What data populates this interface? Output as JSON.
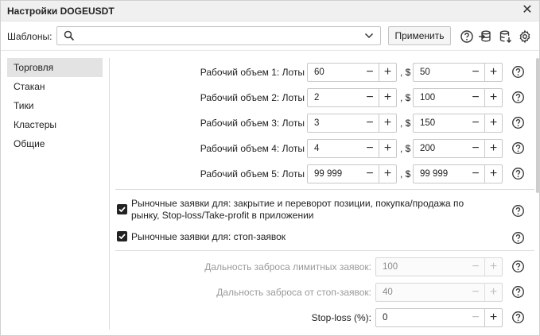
{
  "window": {
    "title": "Настройки DOGEUSDT"
  },
  "templates": {
    "label": "Шаблоны:",
    "value": "",
    "apply_label": "Применить"
  },
  "toolbar_icons": [
    "help-icon",
    "import-icon",
    "database-icon",
    "gear-icon"
  ],
  "sidebar": {
    "items": [
      {
        "label": "Торговля",
        "active": true
      },
      {
        "label": "Стакан",
        "active": false
      },
      {
        "label": "Тики",
        "active": false
      },
      {
        "label": "Кластеры",
        "active": false
      },
      {
        "label": "Общие",
        "active": false
      }
    ]
  },
  "volumes": [
    {
      "label": "Рабочий объем 1: Лоты",
      "lots": "60",
      "usd_sep": ", $",
      "usd": "50"
    },
    {
      "label": "Рабочий объем 2: Лоты",
      "lots": "2",
      "usd_sep": ", $",
      "usd": "100"
    },
    {
      "label": "Рабочий объем 3: Лоты",
      "lots": "3",
      "usd_sep": ", $",
      "usd": "150"
    },
    {
      "label": "Рабочий объем 4: Лоты",
      "lots": "4",
      "usd_sep": ", $",
      "usd": "200"
    },
    {
      "label": "Рабочий объем 5: Лоты",
      "lots": "99 999",
      "usd_sep": ", $",
      "usd": "99 999"
    }
  ],
  "checkboxes": [
    {
      "line1": "Рыночные заявки для: закрытие и переворот позиции, покупка/продажа по",
      "line2": "рынку, Stop-loss/Take-profit в приложении",
      "checked": true
    },
    {
      "line1": "Рыночные заявки для: стоп-заявок",
      "line2": "",
      "checked": true
    }
  ],
  "ranges": [
    {
      "label": "Дальность заброса лимитных заявок:",
      "value": "100",
      "enabled": false
    },
    {
      "label": "Дальность заброса от стоп-заявок:",
      "value": "40",
      "enabled": false
    },
    {
      "label": "Stop-loss (%):",
      "value": "0",
      "enabled": true
    }
  ],
  "colors": {
    "active_sidebar": "#e3e3e3",
    "titlebar": "#f0f0f0",
    "checkbox": "#222222"
  }
}
